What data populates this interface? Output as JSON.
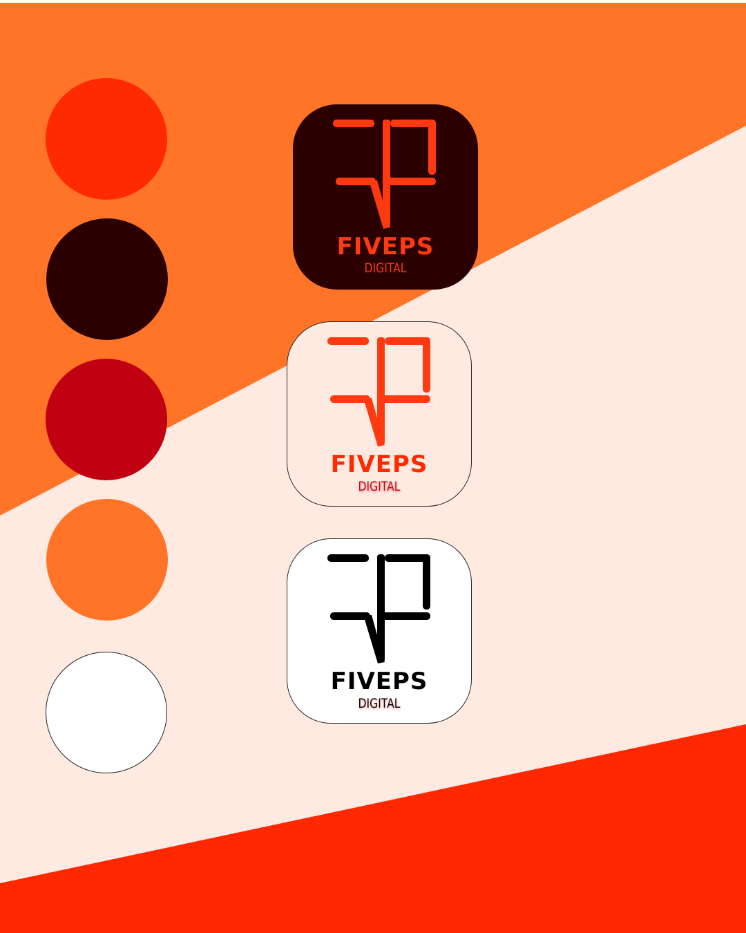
{
  "colors": {
    "background_orange": "#FF7426",
    "background_cream": "#FFEAE2",
    "background_red": "#FF2800",
    "dark_maroon": "#2A0000"
  },
  "palette": {
    "swatches": [
      {
        "name": "red-orange",
        "hex": "#FF2A00"
      },
      {
        "name": "dark-maroon",
        "hex": "#2A0000"
      },
      {
        "name": "crimson",
        "hex": "#C10012"
      },
      {
        "name": "orange",
        "hex": "#FF7426"
      },
      {
        "name": "white",
        "hex": "#FFFFFF"
      }
    ]
  },
  "logos": [
    {
      "variant": "dark",
      "background": "#2A0000",
      "mark_color": "#FF3A10",
      "wordmark": "FIVEPS",
      "subtitle": "DIGITAL",
      "wordmark_color": "#FF3A10",
      "subtitle_color": "#FF3A10"
    },
    {
      "variant": "light",
      "background": "#FFEAE2",
      "mark_color": "#FF3A10",
      "wordmark": "FIVEPS",
      "subtitle": "DIGITAL",
      "wordmark_color": "#FF2A00",
      "subtitle_color": "#C10012"
    },
    {
      "variant": "mono",
      "background": "#FFFFFF",
      "mark_color": "#000000",
      "wordmark": "FIVEPS",
      "subtitle": "DIGITAL",
      "wordmark_color": "#000000",
      "subtitle_color": "#000000"
    }
  ]
}
